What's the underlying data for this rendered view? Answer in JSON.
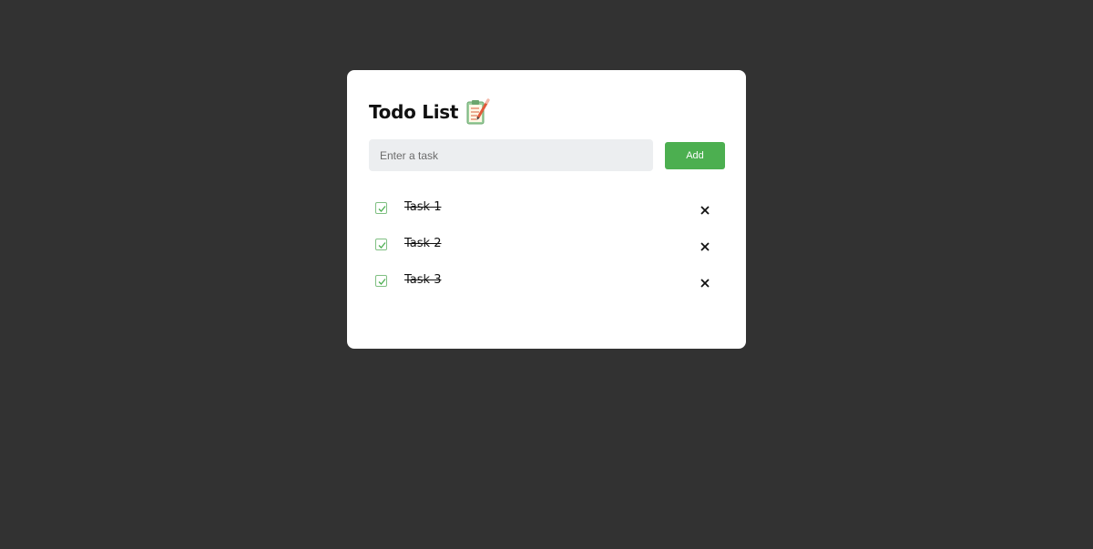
{
  "header": {
    "title": "Todo List",
    "icon": "clipboard-pencil-icon"
  },
  "input": {
    "placeholder": "Enter a task",
    "value": ""
  },
  "add_button": {
    "label": "Add",
    "color": "#4caf50"
  },
  "tasks": [
    {
      "label": "Task 1",
      "completed": true
    },
    {
      "label": "Task 2",
      "completed": true
    },
    {
      "label": "Task 3",
      "completed": true
    }
  ],
  "colors": {
    "background": "#323232",
    "card": "#ffffff",
    "input_bg": "#eceef0",
    "accent": "#4caf50"
  }
}
